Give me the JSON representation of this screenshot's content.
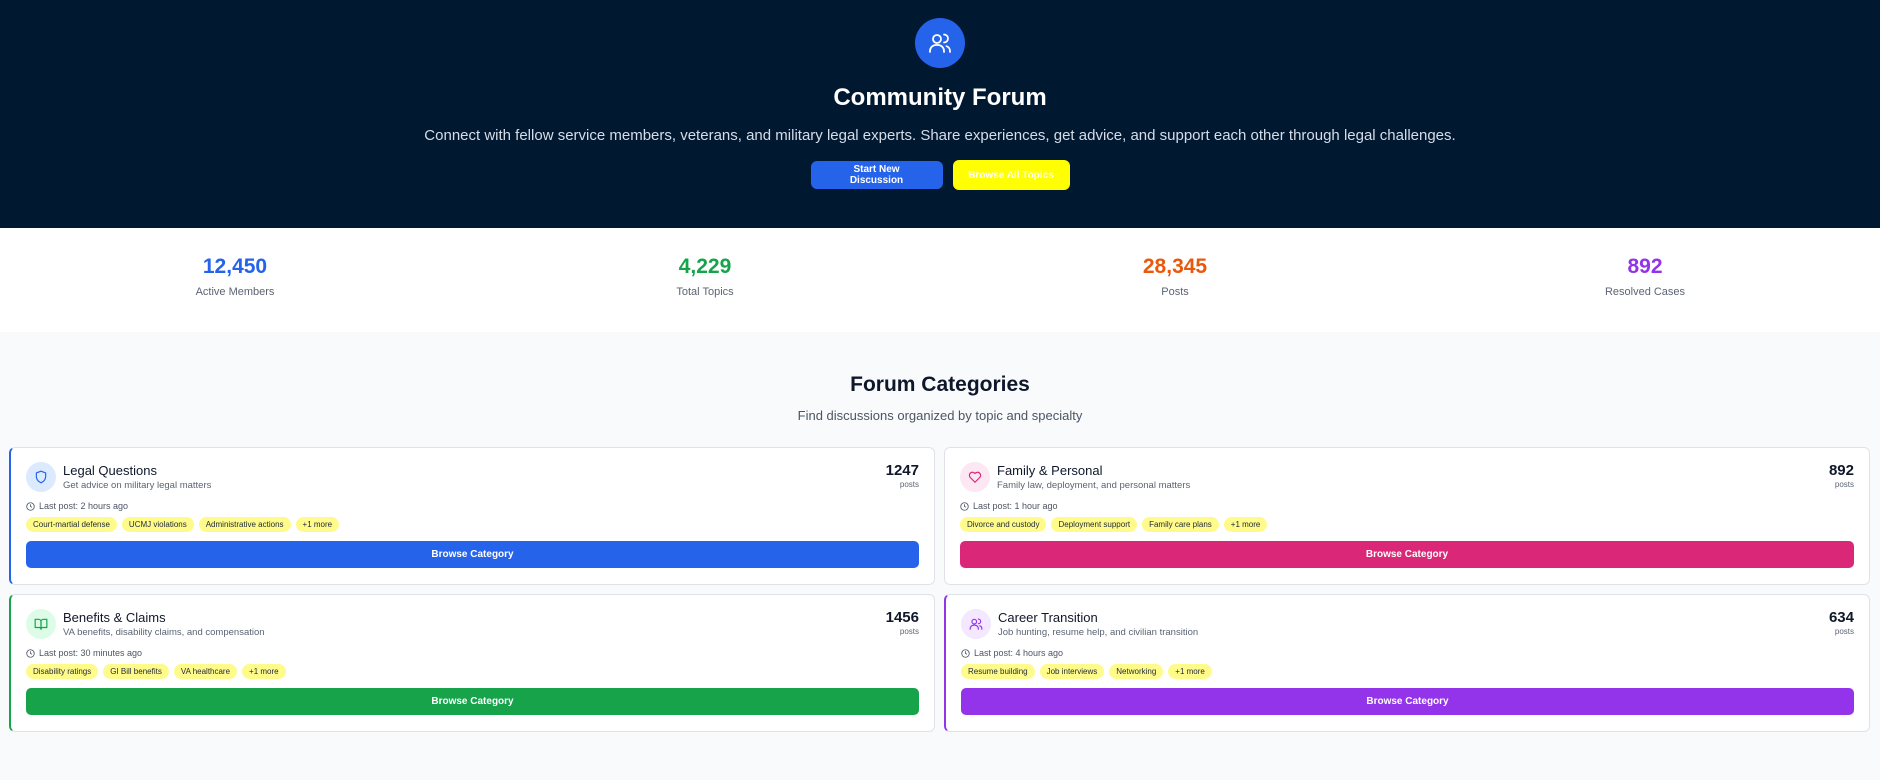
{
  "hero": {
    "title": "Community Forum",
    "subtitle": "Connect with fellow service members, veterans, and military legal experts. Share experiences, get advice, and support each other through legal challenges.",
    "start_button": "Start New Discussion",
    "browse_button": "Browse All Topics",
    "icon": "users-icon"
  },
  "stats": [
    {
      "value": "12,450",
      "label": "Active Members",
      "color": "#2563eb"
    },
    {
      "value": "4,229",
      "label": "Total Topics",
      "color": "#16a34a"
    },
    {
      "value": "28,345",
      "label": "Posts",
      "color": "#ea580c"
    },
    {
      "value": "892",
      "label": "Resolved Cases",
      "color": "#9333ea"
    }
  ],
  "categories_section": {
    "title": "Forum Categories",
    "subtitle": "Find discussions organized by topic and specialty"
  },
  "categories": [
    {
      "name": "Legal Questions",
      "description": "Get advice on military legal matters",
      "count": "1247",
      "count_label": "posts",
      "last_post": "Last post: 2 hours ago",
      "tags": [
        "Court-martial defense",
        "UCMJ violations",
        "Administrative actions",
        "+1 more"
      ],
      "button": "Browse Category",
      "icon": "shield-icon",
      "color": "#2563eb",
      "icon_bg": "#dbeafe"
    },
    {
      "name": "Family & Personal",
      "description": "Family law, deployment, and personal matters",
      "count": "892",
      "count_label": "posts",
      "last_post": "Last post: 1 hour ago",
      "tags": [
        "Divorce and custody",
        "Deployment support",
        "Family care plans",
        "+1 more"
      ],
      "button": "Browse Category",
      "icon": "heart-icon",
      "color": "#db2777",
      "icon_bg": "#fce7f3"
    },
    {
      "name": "Benefits & Claims",
      "description": "VA benefits, disability claims, and compensation",
      "count": "1456",
      "count_label": "posts",
      "last_post": "Last post: 30 minutes ago",
      "tags": [
        "Disability ratings",
        "GI Bill benefits",
        "VA healthcare",
        "+1 more"
      ],
      "button": "Browse Category",
      "icon": "book-icon",
      "color": "#16a34a",
      "icon_bg": "#dcfce7"
    },
    {
      "name": "Career Transition",
      "description": "Job hunting, resume help, and civilian transition",
      "count": "634",
      "count_label": "posts",
      "last_post": "Last post: 4 hours ago",
      "tags": [
        "Resume building",
        "Job interviews",
        "Networking",
        "+1 more"
      ],
      "button": "Browse Category",
      "icon": "users-icon",
      "color": "#9333ea",
      "icon_bg": "#f3e8ff"
    }
  ]
}
